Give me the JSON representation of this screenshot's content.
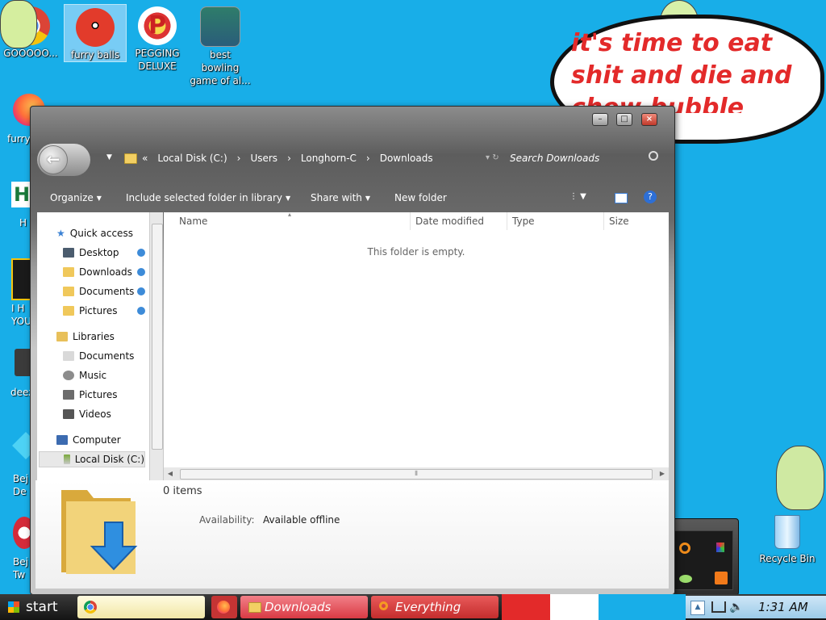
{
  "desktop": {
    "icons": [
      {
        "label": "GOOOOO..."
      },
      {
        "label": "furry balls"
      },
      {
        "label": "PEGGING DELUXE"
      },
      {
        "label": "best bowling game of al..."
      }
    ],
    "left_clipped": [
      "furry",
      "H",
      "I H YOU",
      "deez",
      "Bej De",
      "Bej Tw"
    ],
    "recycle_bin": "Recycle Bin",
    "bubble_text": "it's time to eat shit and die and chew bubble gum"
  },
  "window": {
    "breadcrumb": {
      "prefix": "«",
      "items": [
        "Local Disk (C:)",
        "Users",
        "Longhorn-C",
        "Downloads"
      ],
      "separator": "›"
    },
    "search_placeholder": "Search Downloads",
    "toolbar": {
      "organize": "Organize",
      "include": "Include selected folder in library",
      "share": "Share with",
      "new_folder": "New folder"
    },
    "nav": {
      "quick_access": "Quick access",
      "quick_items": [
        "Desktop",
        "Downloads",
        "Documents",
        "Pictures"
      ],
      "libraries": "Libraries",
      "library_items": [
        "Documents",
        "Music",
        "Pictures",
        "Videos"
      ],
      "computer": "Computer",
      "local_disk": "Local Disk (C:)"
    },
    "columns": [
      "Name",
      "Date modified",
      "Type",
      "Size"
    ],
    "empty_message": "This folder is empty.",
    "details": {
      "count": "0 items",
      "availability_label": "Availability:",
      "availability_value": "Available offline"
    }
  },
  "taskbar": {
    "start": "start",
    "items": [
      "Downloads",
      "Everything"
    ],
    "clock": "1:31 AM"
  },
  "colors": {
    "desktop": "#18aee8",
    "task_downloads": "#e2474d",
    "task_everything": "#d43a3a",
    "bubble_text": "#e32a2a"
  }
}
